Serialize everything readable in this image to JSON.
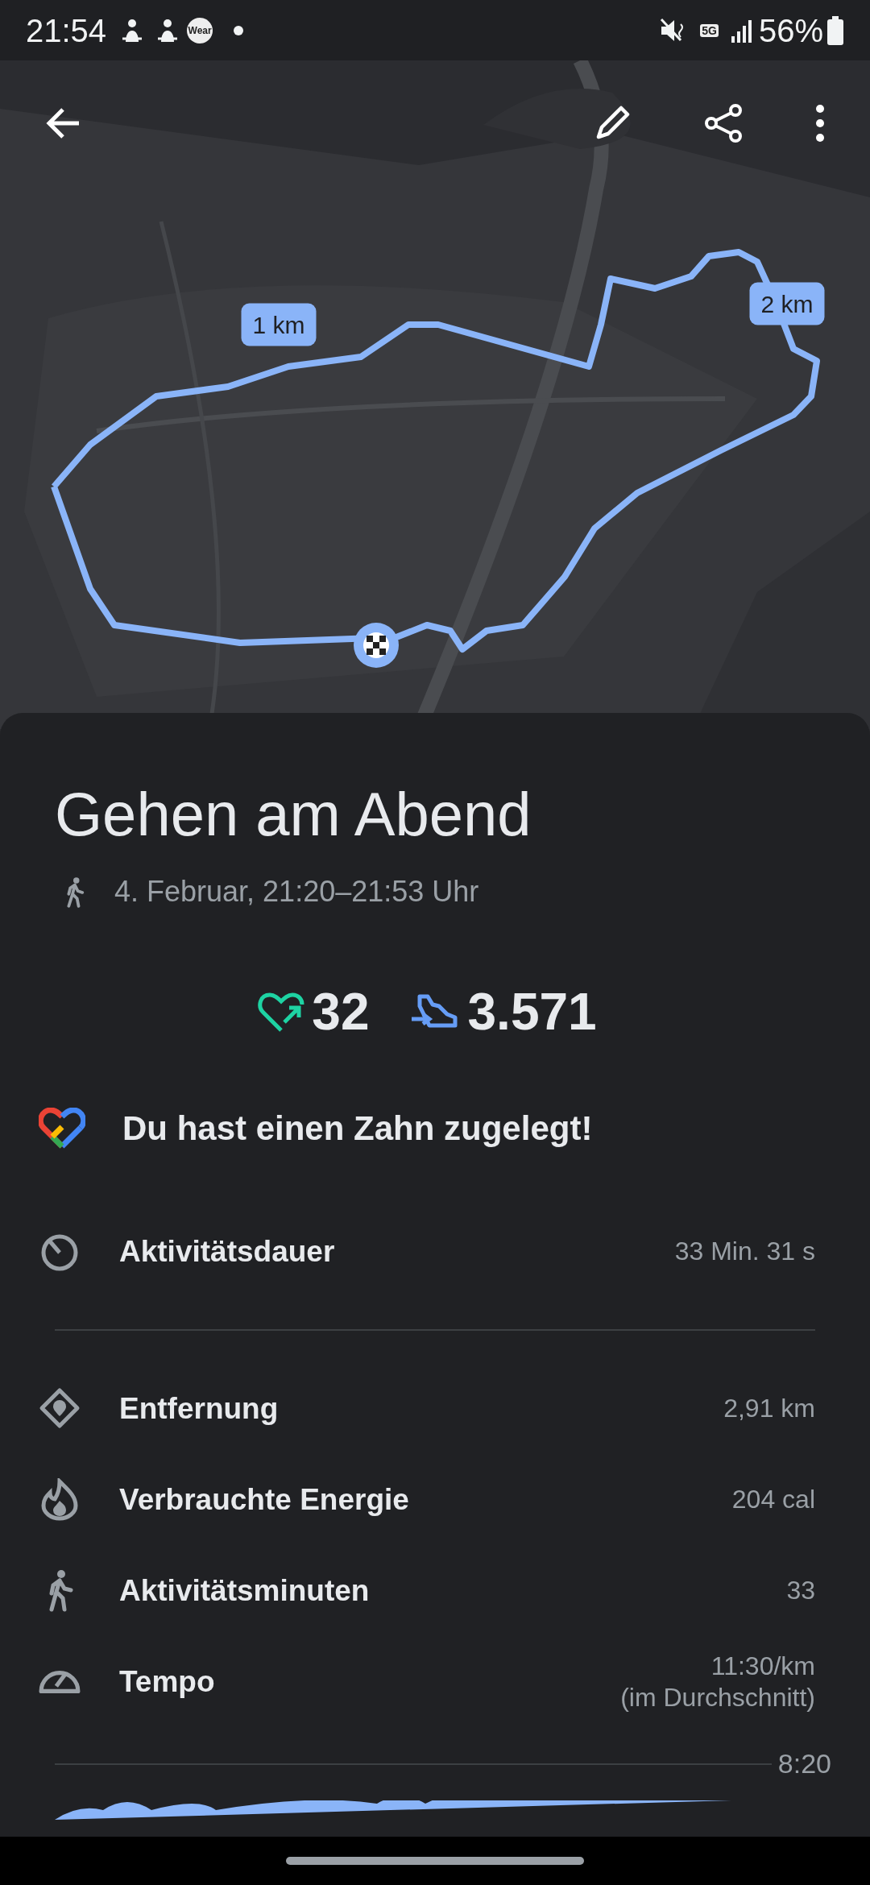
{
  "status_bar": {
    "time": "21:54",
    "wear_badge": "Wear",
    "network": "5G",
    "battery": "56%"
  },
  "map": {
    "kind": "picture",
    "distance_markers": [
      {
        "label": "1 km",
        "kind": "one"
      },
      {
        "label": "2 km",
        "kind": "two"
      }
    ]
  },
  "activity": {
    "title": "Gehen am Abend",
    "datetime": "4. Februar, 21:20–21:53 Uhr",
    "heart_points": "32",
    "steps": "3.571",
    "achievement": "Du hast einen Zahn zugelegt!"
  },
  "primary_stat": {
    "kind": "duration",
    "label": "Aktivitätsdauer",
    "value": "33 Min. 31 s"
  },
  "stats": [
    {
      "kind": "distance",
      "label": "Entfernung",
      "value": "2,91 km"
    },
    {
      "kind": "energy",
      "label": "Verbrauchte Energie",
      "value": "204 cal"
    },
    {
      "kind": "minutes",
      "label": "Aktivitätsminuten",
      "value": "33"
    },
    {
      "kind": "pace",
      "label": "Tempo",
      "value": "11:30/km",
      "note": "(im Durchschnitt)"
    }
  ],
  "pace_chart": {
    "tick_label": "8:20"
  }
}
